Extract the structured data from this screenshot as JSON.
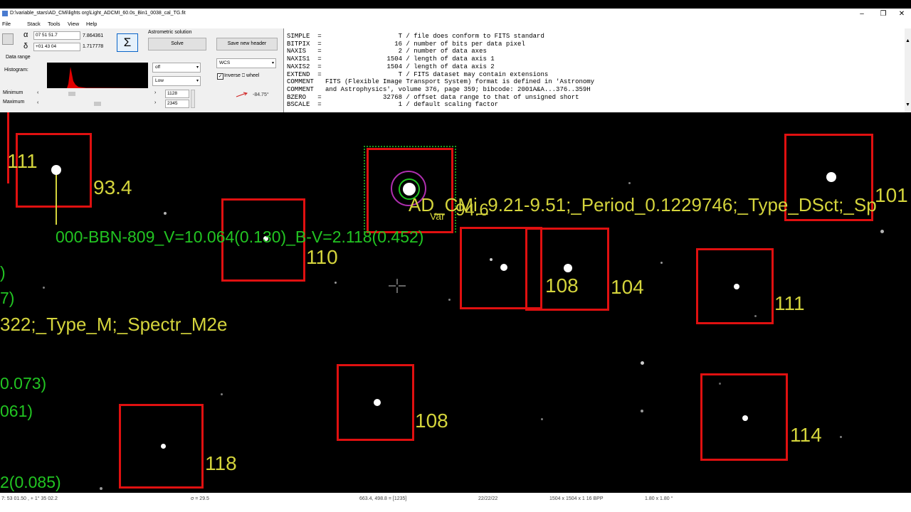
{
  "window": {
    "title": "D:\\variable_stars\\AD_CMi\\lights org\\Light_ADCMI_60.0s_Bin1_0038_cal_TG.fit"
  },
  "menu": [
    "File",
    "Stack",
    "Tools",
    "View",
    "Help"
  ],
  "panel": {
    "alpha_symbol": "α",
    "delta_symbol": "δ",
    "alpha_value": "07 51 51.7",
    "alpha_decimal": "7.864361",
    "delta_value": "+01 43 04",
    "delta_decimal": "1.717778",
    "sum_symbol": "Σ",
    "astrometric_label": "Astrometric solution",
    "solve_label": "Solve",
    "save_header_label": "Save new header",
    "data_range_label": "Data range",
    "histogram_label": "Histogram:",
    "minimum_label": "Minimum",
    "maximum_label": "Maximum",
    "minimum_value": "1128",
    "maximum_value": "2345",
    "range_select": "off",
    "level_select": "Low",
    "wcs_select": "WCS",
    "inverse_label": "Inverse ⎕ wheel",
    "angle": "-84.75°"
  },
  "header_lines": [
    "SIMPLE  =                    T / file does conform to FITS standard",
    "BITPIX  =                   16 / number of bits per data pixel",
    "NAXIS   =                    2 / number of data axes",
    "NAXIS1  =                 1504 / length of data axis 1",
    "NAXIS2  =                 1504 / length of data axis 2",
    "EXTEND  =                    T / FITS dataset may contain extensions",
    "COMMENT   FITS (Flexible Image Transport System) format is defined in 'Astronomy",
    "COMMENT   and Astrophysics', volume 376, page 359; bibcode: 2001A&A...376..359H",
    "BZERO   =                32768 / offset data range to that of unsigned short",
    "BSCALE  =                    1 / default scaling factor"
  ],
  "image": {
    "yellow_labels": [
      "111",
      "93.4",
      "110",
      "108",
      "104",
      "111",
      "108",
      "114",
      "118",
      "101",
      "94.6"
    ],
    "green_labels": [
      "000-BBN-809_V=10.064(0.130)_B-V=2.118(0.452)",
      ")",
      "7)",
      "0.073)",
      "061)",
      "2(0.085)"
    ],
    "var_label": "AD_CMi_9.21-9.51;_Period_0.1229746;_Type_DSct;_Sp",
    "var_small": "Var",
    "partial_label": "322;_Type_M;_Spectr_M2e"
  },
  "status": [
    "7: 53  01.50 ,  + 1° 35  02.2",
    "σ = 29.5",
    "663.4, 498.8 = [1235]",
    "22/22/22",
    "1504 x 1504 x 1   16 BPP",
    "1.80 x 1.80 °"
  ]
}
